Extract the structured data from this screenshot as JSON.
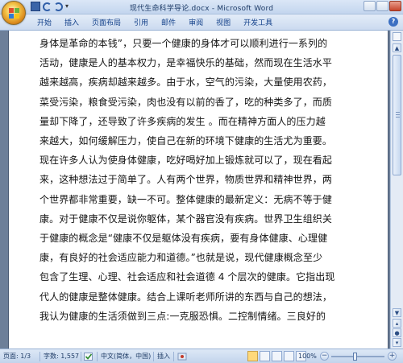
{
  "window": {
    "title": "现代生命科学导论.docx - Microsoft Word"
  },
  "quick_access": {
    "icons": [
      "save-icon",
      "undo-icon",
      "redo-icon",
      "customize-icon"
    ]
  },
  "ribbon": {
    "tabs": [
      {
        "label": "开始"
      },
      {
        "label": "插入"
      },
      {
        "label": "页面布局"
      },
      {
        "label": "引用"
      },
      {
        "label": "邮件"
      },
      {
        "label": "审阅"
      },
      {
        "label": "视图"
      },
      {
        "label": "开发工具"
      }
    ]
  },
  "document": {
    "lines": [
      "身体是革命的本钱”，只要一个健康的身体才可以顺利进行一系列的",
      "活动，健康是人的基本权力，是幸福快乐的基础，然而现在生活水平",
      "越来越高，疾病却越来越多。由于水，空气的污染，大量使用农药，",
      "菜受污染，粮食受污染，肉也没有以前的香了，吃的种类多了，而质",
      "量却下降了，还导致了许多疾病的发生  。而在精神方面人的压力越",
      "来越大，如何缓解压力，使自己在新的环境下健康的生活尤为重要。",
      "现在许多人认为使身体健康，吃好喝好加上锻炼就可以了，现在看起",
      "来，这种想法过于简单了。人有两个世界，物质世界和精神世界，两",
      "个世界都非常重要，缺一不可。整体健康的最新定义：无病不等于健",
      "康。对于健康不仅是说你躯体，某个器官没有疾病。世界卫生组织关",
      "于健康的概念是“健康不仅是躯体没有疾病，要有身体健康、心理健",
      "康，有良好的社会适应能力和道德。”也就是说，现代健康概念至少",
      "包含了生理、心理、社会适应和社会道德 4 个层次的健康。它指出现",
      "代人的健康是整体健康。结合上课听老师所讲的东西与自己的想法，",
      "我认为健康的生活须做到三点:一克服恐惧。二控制情绪。三良好的"
    ]
  },
  "statusbar": {
    "page": "页面: 1/3",
    "words": "字数: 1,557",
    "language": "中文(简体，中国)",
    "mode": "插入",
    "zoom": "100%",
    "zoom_value": 100
  }
}
